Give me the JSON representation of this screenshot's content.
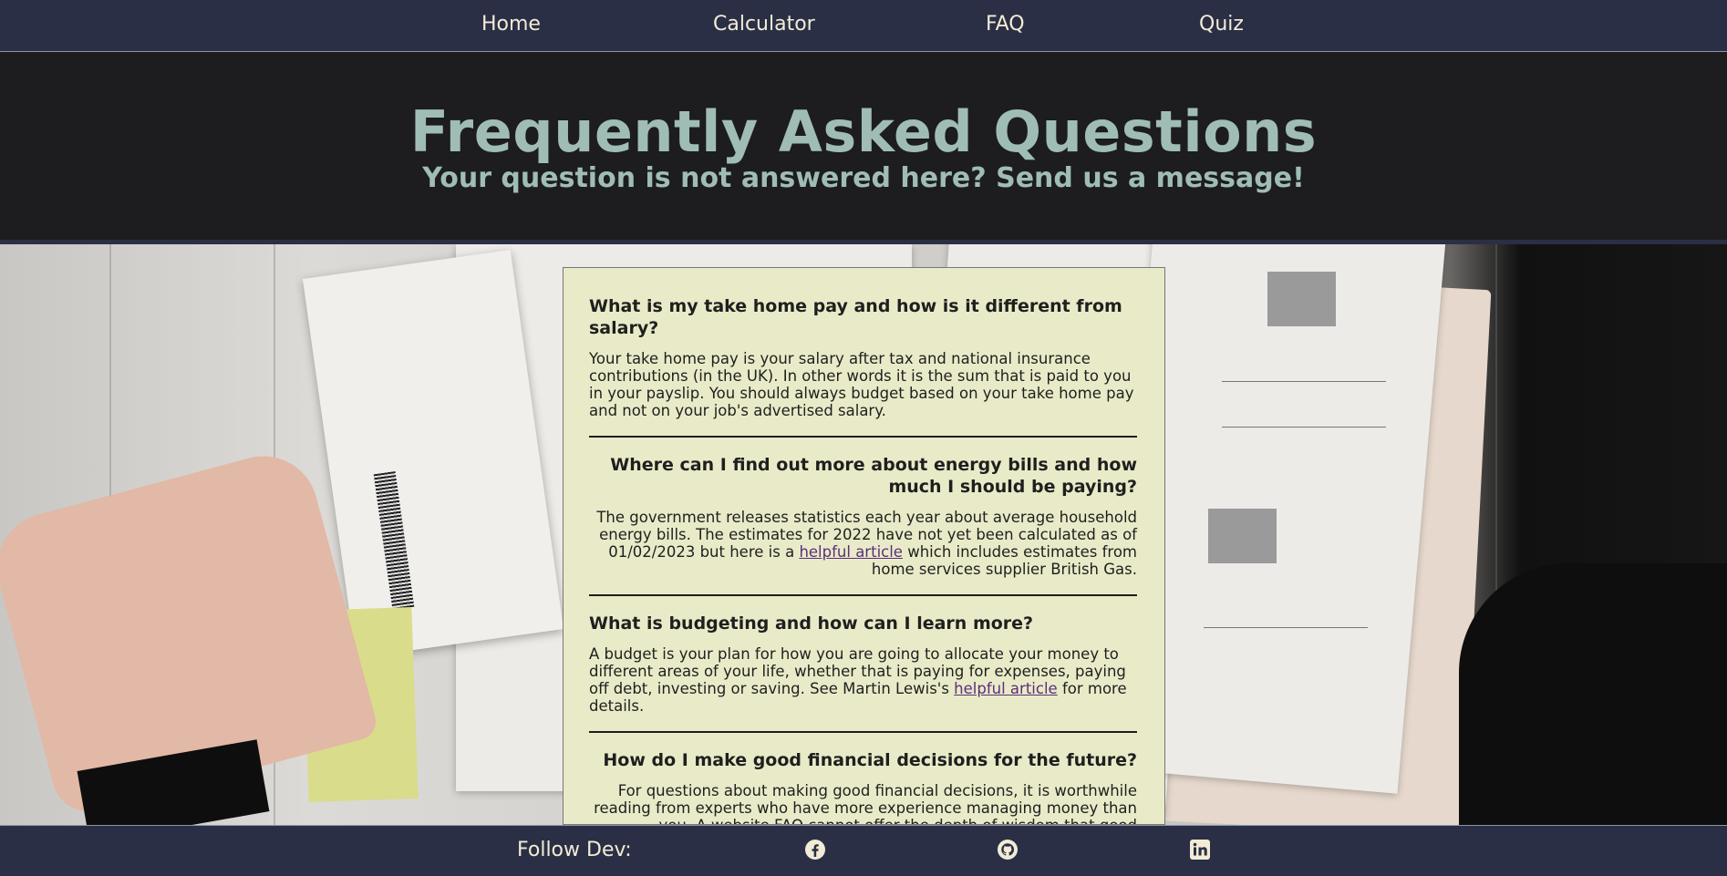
{
  "nav": {
    "items": [
      {
        "label": "Home"
      },
      {
        "label": "Calculator"
      },
      {
        "label": "FAQ"
      },
      {
        "label": "Quiz"
      }
    ]
  },
  "header": {
    "title": "Frequently Asked Questions",
    "subtitle": "Your question is not answered here? Send us a message!"
  },
  "faq": [
    {
      "question": "What is my take home pay and how is it different from salary?",
      "answer": "Your take home pay is your salary after tax and national insurance contributions (in the UK). In other words it is the sum that is paid to you in your payslip. You should always budget based on your take home pay and not on your job's advertised salary."
    },
    {
      "question": "Where can I find out more about energy bills and how much I should be paying?",
      "answer_before": "The government releases statistics each year about average household energy bills. The estimates for 2022 have not yet been calculated as of 01/02/2023 but here is a ",
      "link": "helpful article",
      "answer_after": " which includes estimates from home services supplier British Gas."
    },
    {
      "question": "What is budgeting and how can I learn more?",
      "answer_before": "A budget is your plan for how you are going to allocate your money to different areas of your life, whether that is paying for expenses, paying off debt, investing or saving. See Martin Lewis's ",
      "link": "helpful article",
      "answer_after": " for more details."
    },
    {
      "question": "How do I make good financial decisions for the future?",
      "answer": "For questions about making good financial decisions, it is worthwhile reading from experts who have more experience managing money than you. A website FAQ cannot offer the depth of wisdom that good literature"
    }
  ],
  "footer": {
    "label": "Follow Dev:",
    "icons": [
      "facebook-icon",
      "github-icon",
      "linkedin-icon"
    ]
  },
  "colors": {
    "nav_bg": "#2a2f45",
    "nav_text": "#f2ecd6",
    "hero_bg": "#1d1c1f",
    "hero_text": "#9fbdb4",
    "panel_bg": "#e9ebc8",
    "link": "#5a2f7a"
  }
}
